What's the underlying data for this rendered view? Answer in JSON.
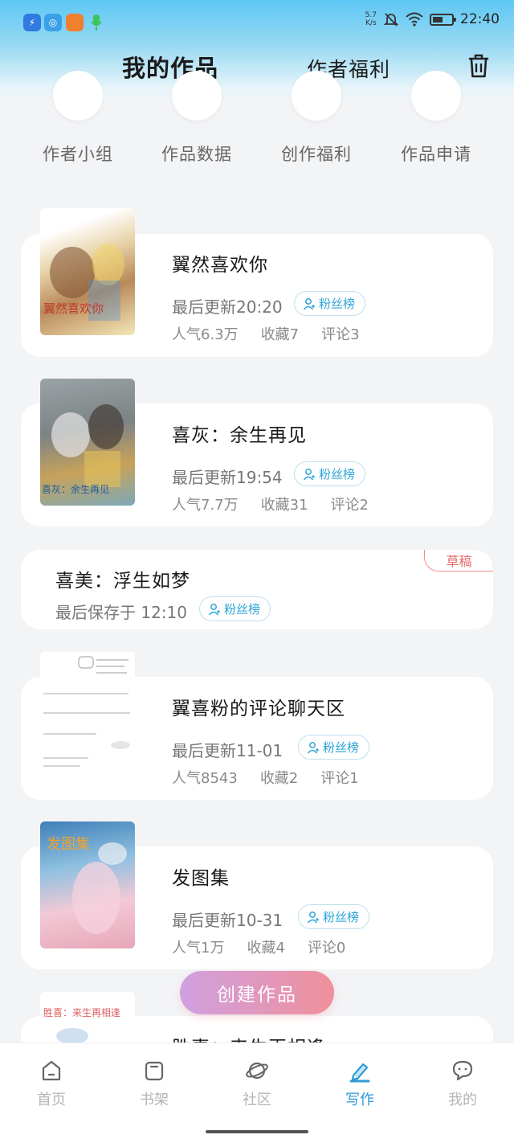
{
  "status_bar": {
    "net_speed_top": "5.7",
    "net_speed_bottom": "K/s",
    "time": "22:40"
  },
  "header": {
    "title": "我的作品",
    "tab2": "作者福利"
  },
  "quick_entries": [
    {
      "label": "作者小组"
    },
    {
      "label": "作品数据"
    },
    {
      "label": "创作福利"
    },
    {
      "label": "作品申请"
    }
  ],
  "works": [
    {
      "title": "翼然喜欢你",
      "update": "最后更新20:20",
      "fan_label": "粉丝榜",
      "popularity": "人气6.3万",
      "favorites": "收藏7",
      "comments": "评论3"
    },
    {
      "title": "喜灰：余生再见",
      "update": "最后更新19:54",
      "fan_label": "粉丝榜",
      "popularity": "人气7.7万",
      "favorites": "收藏31",
      "comments": "评论2"
    },
    {
      "title": "喜美：浮生如梦",
      "update": "最后保存于 12:10",
      "fan_label": "粉丝榜",
      "draft_badge": "草稿"
    },
    {
      "title": "翼喜粉的评论聊天区",
      "update": "最后更新11-01",
      "fan_label": "粉丝榜",
      "popularity": "人气8543",
      "favorites": "收藏2",
      "comments": "评论1"
    },
    {
      "title": "发图集",
      "update": "最后更新10-31",
      "fan_label": "粉丝榜",
      "popularity": "人气1万",
      "favorites": "收藏4",
      "comments": "评论0"
    },
    {
      "title": "胜喜：来生再相逢"
    }
  ],
  "covers": {
    "c1": "翼然喜欢你",
    "c2": "喜灰：余生再见",
    "c5": "发图集",
    "c6": "胜喜：来生再相逢"
  },
  "fab_label": "创建作品",
  "nav": [
    {
      "label": "首页"
    },
    {
      "label": "书架"
    },
    {
      "label": "社区"
    },
    {
      "label": "写作"
    },
    {
      "label": "我的"
    }
  ],
  "colors": {
    "accent": "#2e9bd6",
    "draft": "#e56a6a",
    "fab_start": "#cfa0e0",
    "fab_end": "#f0909a"
  }
}
